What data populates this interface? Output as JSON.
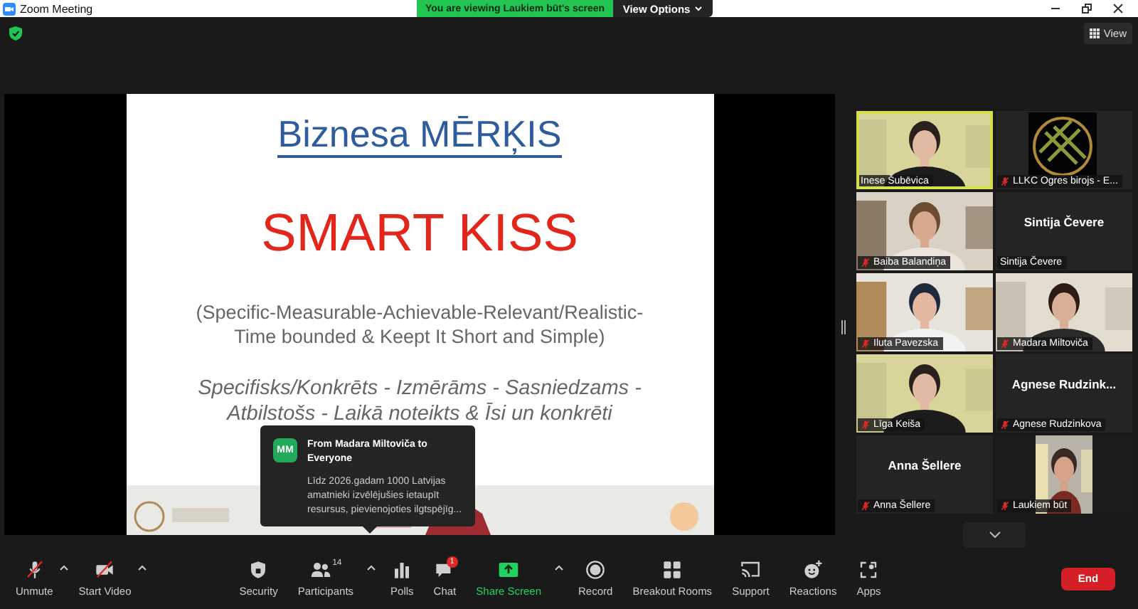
{
  "window": {
    "title": "Zoom Meeting"
  },
  "banner": {
    "text": "You are viewing Laukiem būt's screen",
    "options": "View Options"
  },
  "view_button": {
    "label": "View"
  },
  "slide": {
    "title": "Biznesa MĒRĶIS",
    "headline": "SMART KISS",
    "subtitle_lines": [
      "(Specific-Measurable-Achievable-Relevant/Realistic-",
      "Time bounded & Keept It Short and Simple)"
    ],
    "translation_lines": [
      "Specifisks/Konkrēts - Izmērāms - Sasniedzams -",
      "Atbilstošs - Laikā noteikts & Īsi un konkrēti"
    ]
  },
  "chat_popup": {
    "avatar": "MM",
    "sender": "From Madara Miltoviča to Everyone",
    "message": "Līdz 2026.gadam 1000 Latvijas amatnieki izvēlējušies ietaupīt resursus, pievienojoties ilgtspējīg..."
  },
  "participants": [
    {
      "name": "Inese Šubēvica",
      "kind": "video",
      "muted": false,
      "speaking": true
    },
    {
      "name": "LLKC Ogres birojs - E...",
      "kind": "logo",
      "muted": true,
      "speaking": false
    },
    {
      "name": "Baiba Balandiņa",
      "kind": "video",
      "muted": true,
      "speaking": false
    },
    {
      "name": "Sintija Čevere",
      "kind": "name_only",
      "display_name": "Sintija Čevere",
      "muted": false,
      "speaking": false
    },
    {
      "name": "Iluta Pavezska",
      "kind": "video",
      "muted": true,
      "speaking": false
    },
    {
      "name": "Madara Miltoviča",
      "kind": "video",
      "muted": true,
      "speaking": false
    },
    {
      "name": "Līga Keiša",
      "kind": "video",
      "muted": true,
      "speaking": false
    },
    {
      "name": "Agnese Rudzinkova",
      "kind": "name_only",
      "display_name": "Agnese  Rudzink...",
      "muted": true,
      "speaking": false
    },
    {
      "name": "Anna Šellere",
      "kind": "name_only",
      "display_name": "Anna Šellere",
      "muted": true,
      "speaking": false
    },
    {
      "name": "Laukiem būt",
      "kind": "video",
      "muted": true,
      "speaking": false
    }
  ],
  "toolbar": {
    "left": [
      {
        "kind": "mic",
        "label": "Unmute",
        "muted": true,
        "caret": true
      },
      {
        "kind": "video",
        "label": "Start Video",
        "muted": true,
        "caret": true
      }
    ],
    "center": [
      {
        "kind": "security",
        "label": "Security",
        "caret": false
      },
      {
        "kind": "participants",
        "label": "Participants",
        "count": "14",
        "caret": true
      },
      {
        "kind": "polls",
        "label": "Polls",
        "caret": false
      },
      {
        "kind": "chat",
        "label": "Chat",
        "badge": "1",
        "caret": false
      },
      {
        "kind": "share",
        "label": "Share Screen",
        "caret": true
      },
      {
        "kind": "record",
        "label": "Record",
        "caret": false
      },
      {
        "kind": "breakout",
        "label": "Breakout Rooms",
        "caret": false
      },
      {
        "kind": "support",
        "label": "Support",
        "caret": false
      },
      {
        "kind": "reactions",
        "label": "Reactions",
        "caret": false
      },
      {
        "kind": "apps",
        "label": "Apps",
        "caret": false
      }
    ],
    "end_button": {
      "label": "End"
    }
  }
}
